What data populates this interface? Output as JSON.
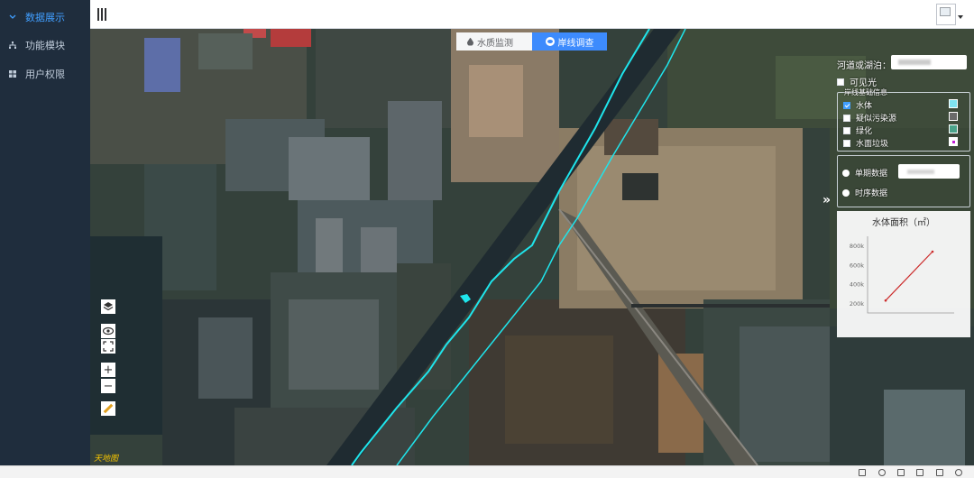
{
  "sidebar": {
    "items": [
      {
        "label": "数据展示",
        "icon": "chevron-down-icon",
        "active": true
      },
      {
        "label": "功能模块",
        "icon": "hierarchy-icon",
        "active": false
      },
      {
        "label": "用户权限",
        "icon": "grid-icon",
        "active": false
      }
    ]
  },
  "tabs": [
    {
      "label": "水质监测",
      "icon": "water-drop-icon",
      "active": false
    },
    {
      "label": "岸线调查",
      "icon": "eye-icon",
      "active": true
    }
  ],
  "panel": {
    "river_label": "河道或湖泊：",
    "visible_light_label": "可见光",
    "info_group_title": "岸线基础信息",
    "layers": [
      {
        "label": "水体",
        "checked": true,
        "color": "#7fe3f0"
      },
      {
        "label": "疑似污染源",
        "checked": false,
        "color": "#6a6a6a"
      },
      {
        "label": "绿化",
        "checked": false,
        "color": "#4aa38a"
      },
      {
        "label": "水面垃圾",
        "checked": false,
        "color": "#c21fd6"
      }
    ],
    "period_options": [
      "单期数据",
      "时序数据"
    ]
  },
  "chart_data": {
    "type": "line",
    "title": "水体面积（㎡）",
    "y_ticks": [
      "800k",
      "600k",
      "400k",
      "200k"
    ],
    "ylim": [
      100000,
      900000
    ],
    "series": [
      {
        "values": [
          230000,
          740000
        ],
        "color": "#cc2b2b"
      }
    ]
  },
  "map": {
    "watermark": "天地图"
  },
  "colors": {
    "sidebar_bg": "#1f2d3d",
    "accent": "#409eff",
    "water_line": "#1fe5ec"
  }
}
